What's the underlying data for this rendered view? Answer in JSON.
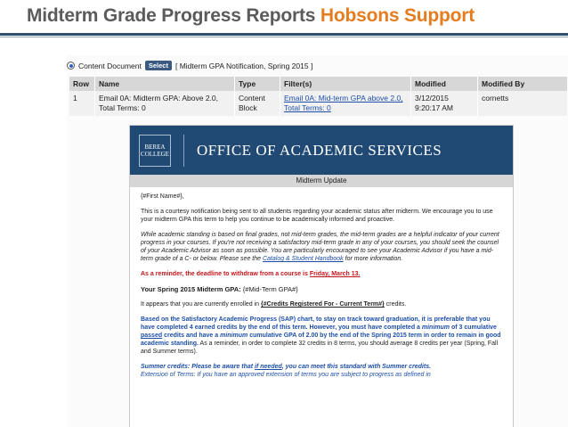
{
  "slide": {
    "title": "Midterm Grade Progress Reports",
    "brand": "Hobsons Support"
  },
  "content_doc": {
    "label": "Content Document",
    "select_label": "Select",
    "current": "[ Midterm GPA Notification, Spring 2015 ]"
  },
  "table": {
    "headers": [
      "Row",
      "Name",
      "Type",
      "Filter(s)",
      "Modified",
      "Modified By"
    ],
    "row": {
      "num": "1",
      "name_line1": "Email 0A: Midterm GPA: Above 2.0,",
      "name_line2": "Total Terms: 0",
      "type_line1": "Content",
      "type_line2": "Block",
      "filter_line1": "Email 0A: Mid-term GPA above 2.0,",
      "filter_line2": "Total Terms: 0",
      "modified_line1": "3/12/2015",
      "modified_line2": "9:20:17 AM",
      "modified_by": "cornetts"
    }
  },
  "email": {
    "logo_line1": "BEREA",
    "logo_line2": "COLLEGE",
    "office_title": "OFFICE OF ACADEMIC SERVICES",
    "update_bar": "Midterm Update",
    "greeting": "{#First Name#},",
    "para1": "This is a courtesy notification being sent to all students regarding your academic status after midterm. We encourage you to use your midterm GPA this term to help you continue to be academically informed and proactive.",
    "para2a": "While academic standing is based on final grades, not mid-term grades, the mid-term grades are a helpful indicator of your current progress in your courses. If you're not receiving a satisfactory mid-term grade in any of your courses, you should seek the counsel of your Academic Advisor as soon as possible. You are particularly encouraged to see your Academic Advisor if you have a mid-term grade of a C- or below. Please see the",
    "para2_link": "Catalog & Student Handbook",
    "para2b": "for more information.",
    "reminder_a": "As a reminder, the deadline to withdraw from a course is",
    "reminder_date": "Friday, March 13.",
    "gpa_label": "Your Spring 2015 Midterm GPA:",
    "gpa_value": "{#Mid-Term GPA#}",
    "enrolled_a": "It appears that you are currently enrolled in",
    "enrolled_var": "{#Credits Registered For - Current Term#}",
    "enrolled_b": "credits.",
    "sap_a": "Based on the Satisfactory Academic Progress (SAP) chart, to stay on track toward graduation, it is preferable that you have completed 4 earned credits by the end of this term. However, you must have completed a",
    "sap_min1": "minimum",
    "sap_b": "of 3 cumulative",
    "sap_passed": "passed",
    "sap_c": "credits and have a",
    "sap_min2": "minimum",
    "sap_d": "cumulative GPA of 2.00 by the end of the Spring 2015 term in order to remain in good academic standing.",
    "sap_e": "As a reminder, in order to complete 32 credits in 8 terms, you should average 8 credits per year (Spring, Fall and Summer terms).",
    "summer_label": "Summer credits:",
    "summer_a": "Please be aware that",
    "summer_ifneeded": "if needed",
    "summer_b": ", you can meet this standard with Summer credits.",
    "extension": "Extension of Terms: If you have an approved extension of terms you are subject to progress as defined in"
  }
}
